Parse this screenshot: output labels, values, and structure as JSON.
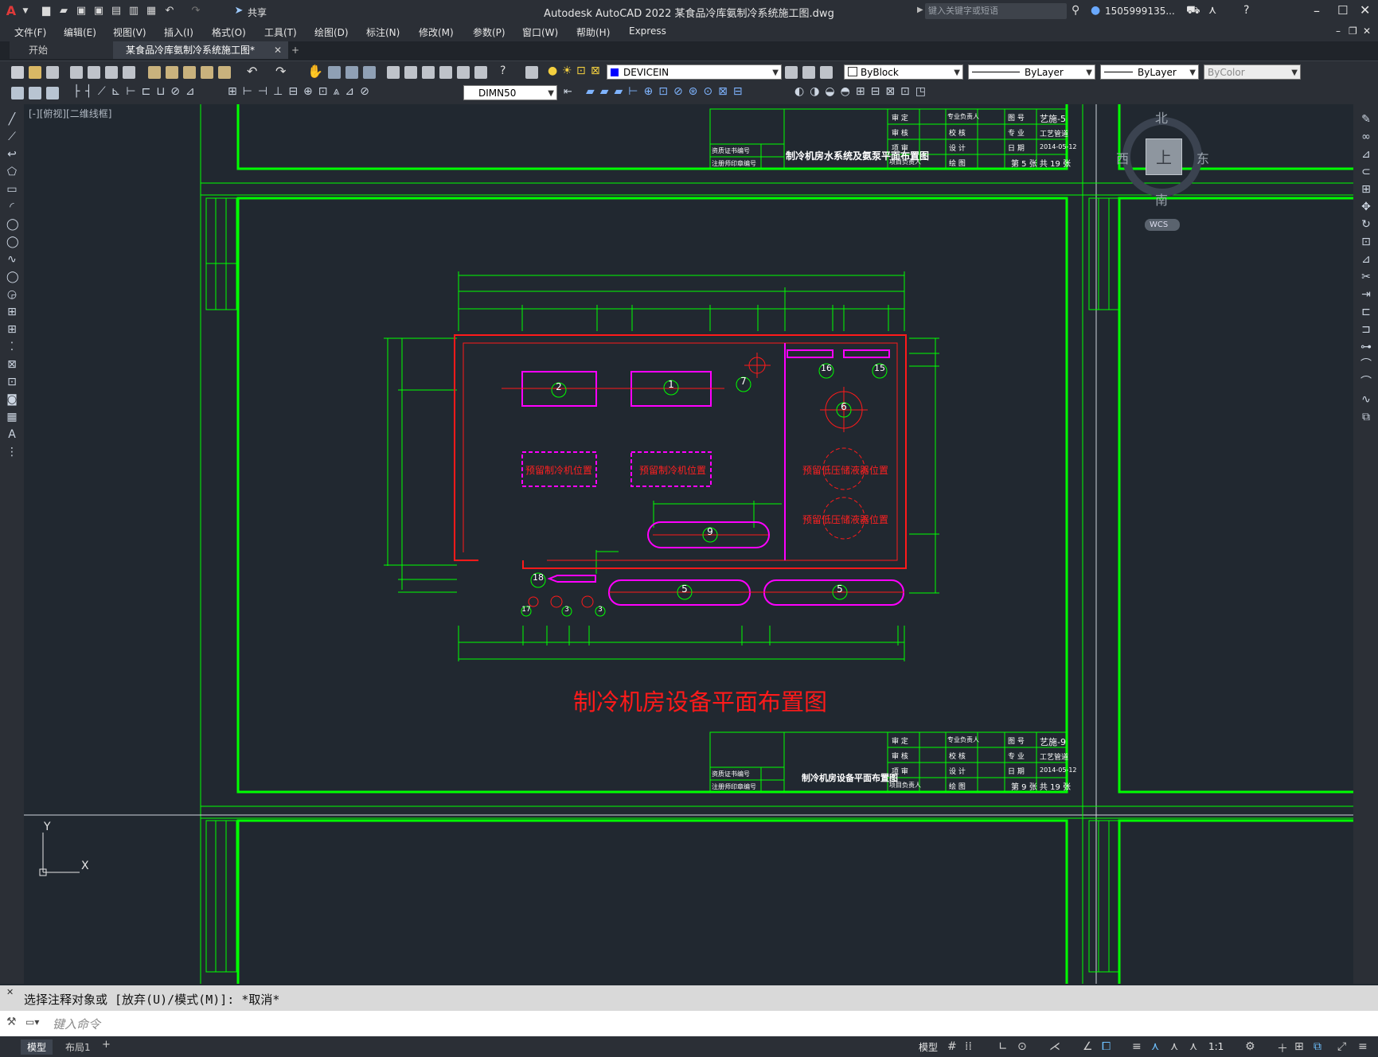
{
  "window": {
    "title": "Autodesk AutoCAD 2022    某食品冷库氨制冷系统施工图.dwg",
    "share_label": "共享",
    "search_placeholder": "键入关键字或短语",
    "user": "1505999135...",
    "app_letter": "A"
  },
  "menu": [
    "文件(F)",
    "编辑(E)",
    "视图(V)",
    "插入(I)",
    "格式(O)",
    "工具(T)",
    "绘图(D)",
    "标注(N)",
    "修改(M)",
    "参数(P)",
    "窗口(W)",
    "帮助(H)",
    "Express"
  ],
  "tabs": {
    "start": "开始",
    "document": "某食品冷库氨制冷系统施工图*",
    "add": "+"
  },
  "toolbar": {
    "layer": "DEVICEIN",
    "color": "ByBlock",
    "linetype": "ByLayer",
    "lineweight": "ByLayer",
    "plotstyle": "ByColor",
    "dimstyle": "DIMN50"
  },
  "viewport": {
    "label": "[-][俯视][二维线框]",
    "compass": {
      "n": "北",
      "s": "南",
      "e": "东",
      "w": "西",
      "top": "上"
    },
    "wcs": "WCS"
  },
  "drawing": {
    "main_title": "制冷机房设备平面布置图",
    "reserve_chiller_1": "预留制冷机位置",
    "reserve_chiller_2": "预留制冷机位置",
    "reserve_hp_1": "预留低压储液器位置",
    "reserve_hp_2": "预留低压储液器位置",
    "equipment_tags": [
      "2",
      "1",
      "7",
      "16",
      "15",
      "6",
      "9",
      "18",
      "5",
      "5",
      "17",
      "3",
      "3"
    ],
    "titleblock_top": {
      "drawing_name": "制冷机房水系统及氨泵平面布置图",
      "drawing_no": "艺施-5",
      "discipline": "工艺管道",
      "date": "2014-05-12",
      "sheet": "第 5 张 共 19 张",
      "cells": [
        "审 定",
        "审 核",
        "项 审",
        "项目负责人",
        "专业负责人",
        "校 核",
        "设 计",
        "绘 图",
        "图 号",
        "专 业",
        "日 期",
        "资质证书编号",
        "注册师印章编号"
      ]
    },
    "titleblock_bottom": {
      "drawing_name": "制冷机房设备平面布置图",
      "drawing_no": "艺施-9",
      "discipline": "工艺管道",
      "date": "2014-05-12",
      "sheet": "第 9 张 共 19 张",
      "cells": [
        "审 定",
        "审 核",
        "项 审",
        "项目负责人",
        "专业负责人",
        "校 核",
        "设 计",
        "绘 图",
        "图 号",
        "专 业",
        "日 期",
        "资质证书编号",
        "注册师印章编号"
      ]
    },
    "ucs": {
      "x": "X",
      "y": "Y"
    }
  },
  "command": {
    "history": "选择注释对象或 [放弃(U)/模式(M)]: *取消*",
    "placeholder": "键入命令"
  },
  "status": {
    "layout_tabs": [
      "模型",
      "布局1",
      "+"
    ],
    "model_label": "模型",
    "scale": "1:1"
  }
}
